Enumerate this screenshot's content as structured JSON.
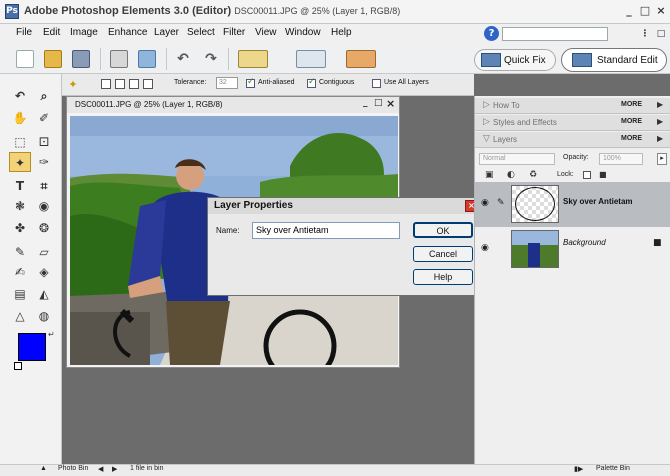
{
  "app": {
    "title": "Adobe Photoshop Elements 3.0 (Editor)",
    "document": "DSC00011.JPG @ 25% (Layer 1, RGB/8)",
    "logo_glyph": "Ps"
  },
  "window_controls": {
    "minimize": "_",
    "maximize": "□",
    "close": "×"
  },
  "menu": [
    "File",
    "Edit",
    "Image",
    "Enhance",
    "Layer",
    "Select",
    "Filter",
    "View",
    "Window",
    "Help"
  ],
  "help_icon": "?",
  "toolbar": {
    "quick_fix": "Quick Fix",
    "standard_edit": "Standard Edit"
  },
  "options_bar": {
    "tolerance_label": "Tolerance:",
    "tolerance_value": "32",
    "anti_aliased": "Anti-aliased",
    "contiguous": "Contiguous",
    "use_all_layers": "Use All Layers"
  },
  "tools": {
    "move": "↶",
    "zoom": "⌕",
    "hand": "✋",
    "eyedropper": "✐",
    "marquee": "⬚",
    "lasso": "⚀",
    "magic_wand": "✦",
    "selection_brush": "✑",
    "type": "T",
    "crop": "⌗",
    "cookie_cutter": "❃",
    "red_eye": "◉",
    "healing": "✤",
    "clone": "❂",
    "pencil": "✎",
    "eraser": "▱",
    "brush": "✍",
    "paint_bucket": "◈",
    "gradient": "▤",
    "shape": "◭",
    "blur": "△",
    "sponge": "◍"
  },
  "doc_window": {
    "title": "DSC00011.JPG @ 25% (Layer 1, RGB/8)",
    "min": "_",
    "max": "□",
    "close": "×"
  },
  "dialog": {
    "title": "Layer Properties",
    "close": "×",
    "name_label": "Name:",
    "name_value": "Sky over Antietam",
    "ok": "OK",
    "cancel": "Cancel",
    "help": "Help"
  },
  "palettes": {
    "how_to": "How To",
    "styles": "Styles and Effects",
    "layers": "Layers",
    "more": "MORE",
    "blend_mode": "Normal",
    "opacity_label": "Opacity:",
    "opacity_value": "100%",
    "lock_label": "Lock:"
  },
  "layers": [
    {
      "name": "Sky over Antietam"
    },
    {
      "name": "Background"
    }
  ],
  "status": {
    "photo_bin": "Photo Bin",
    "files": "1 file in bin",
    "palette_bin": "Palette Bin"
  },
  "colors": {
    "foreground": "#0000ff",
    "dialog_close": "#d63a2e",
    "help_icon": "#2f63c8"
  }
}
